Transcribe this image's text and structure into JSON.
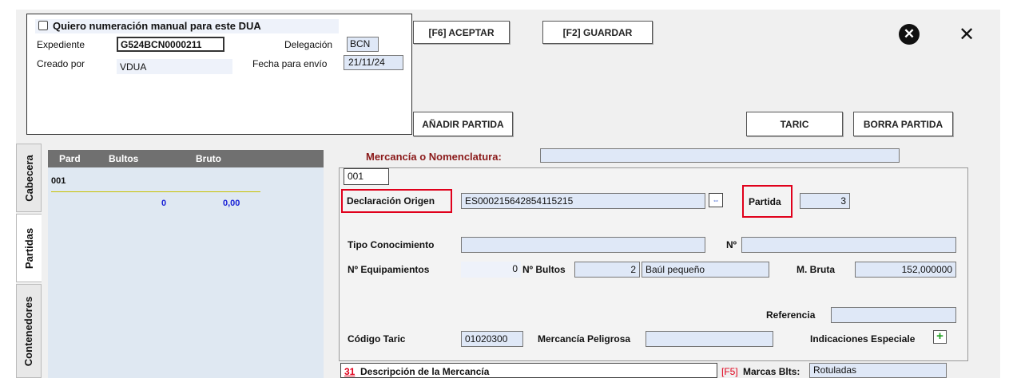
{
  "header": {
    "manual_numbering_label": "Quiero numeración manual para este DUA",
    "expediente_label": "Expediente",
    "expediente_value": "G524BCN0000211",
    "delegacion_label": "Delegación",
    "delegacion_value": "BCN",
    "creado_por_label": "Creado por",
    "creado_por_value": "VDUA",
    "fecha_envio_label": "Fecha para envío",
    "fecha_envio_value": "21/11/24"
  },
  "toolbar": {
    "aceptar_label": "[F6] ACEPTAR",
    "guardar_label": "[F2] GUARDAR",
    "anadir_partida_label": "AÑADIR PARTIDA",
    "taric_label": "TARIC",
    "borra_partida_label": "BORRA PARTIDA"
  },
  "tabs": [
    "Cabecera",
    "Partidas",
    "Contenedores"
  ],
  "list": {
    "columns": [
      "Pard",
      "Bultos",
      "Bruto"
    ],
    "row_id": "001",
    "bultos_total": "0",
    "bruto_total": "0,00"
  },
  "detail": {
    "mercancia_label": "Mercancía o Nomenclatura:",
    "mercancia_value": "",
    "item_number": "001",
    "declaracion_origen_label": "Declaración Origen",
    "declaracion_origen_value": "ES000215642854115215",
    "partida_label": "Partida",
    "partida_value": "3",
    "tipo_conocimiento_label": "Tipo Conocimiento",
    "tipo_conocimiento_value": "",
    "numero_label": "Nº",
    "numero_value": "",
    "equipamientos_label": "Nº Equipamientos",
    "equipamientos_value": "0",
    "bultos_label": "Nº Bultos",
    "bultos_value": "2",
    "bultos_type_value": "Baúl pequeño",
    "masa_bruta_label": "M. Bruta",
    "masa_bruta_value": "152,000000",
    "referencia_label": "Referencia",
    "referencia_value": "",
    "codigo_taric_label": "Código Taric",
    "codigo_taric_value": "01020300",
    "mercancia_peligrosa_label": "Mercancía Peligrosa",
    "mercancia_peligrosa_value": "",
    "indicaciones_label": "Indicaciones Especiale",
    "descripcion_number": "31",
    "descripcion_label": "Descripción de la Mercancía",
    "marcas_key": "[F5]",
    "marcas_label": "Marcas Blts:",
    "marcas_value": "Rotuladas"
  },
  "colors": {
    "highlight": "#e0001b",
    "field_bg": "#dfe8f7",
    "title_red": "#8b1a1a"
  }
}
